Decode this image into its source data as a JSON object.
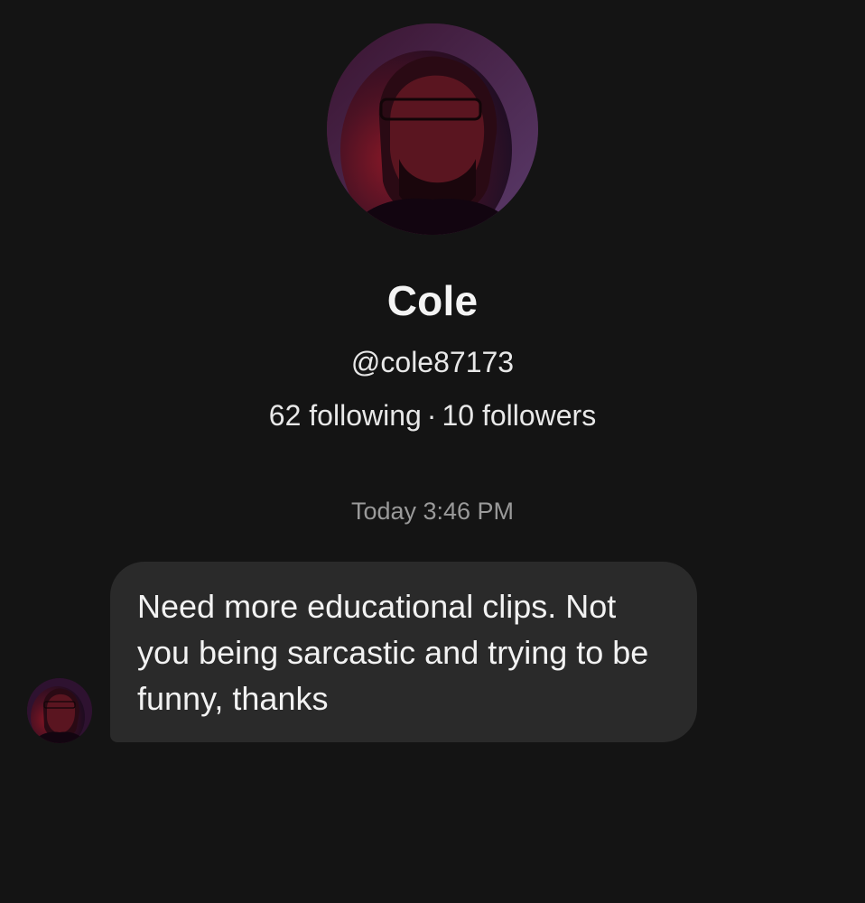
{
  "profile": {
    "avatar_icon": "user-avatar-photo",
    "display_name": "Cole",
    "username": "@cole87173",
    "following": "62 following",
    "separator": "·",
    "followers": "10 followers"
  },
  "conversation": {
    "timestamp": "Today 3:46 PM",
    "messages": [
      {
        "sender_avatar_icon": "user-avatar-photo",
        "text": "Need more educational clips. Not you being sarcastic and trying to be funny, thanks"
      }
    ]
  },
  "colors": {
    "background": "#141414",
    "bubble": "#2a2a2a",
    "text_primary": "#f2f2f2",
    "text_secondary": "#9a9a9a"
  }
}
